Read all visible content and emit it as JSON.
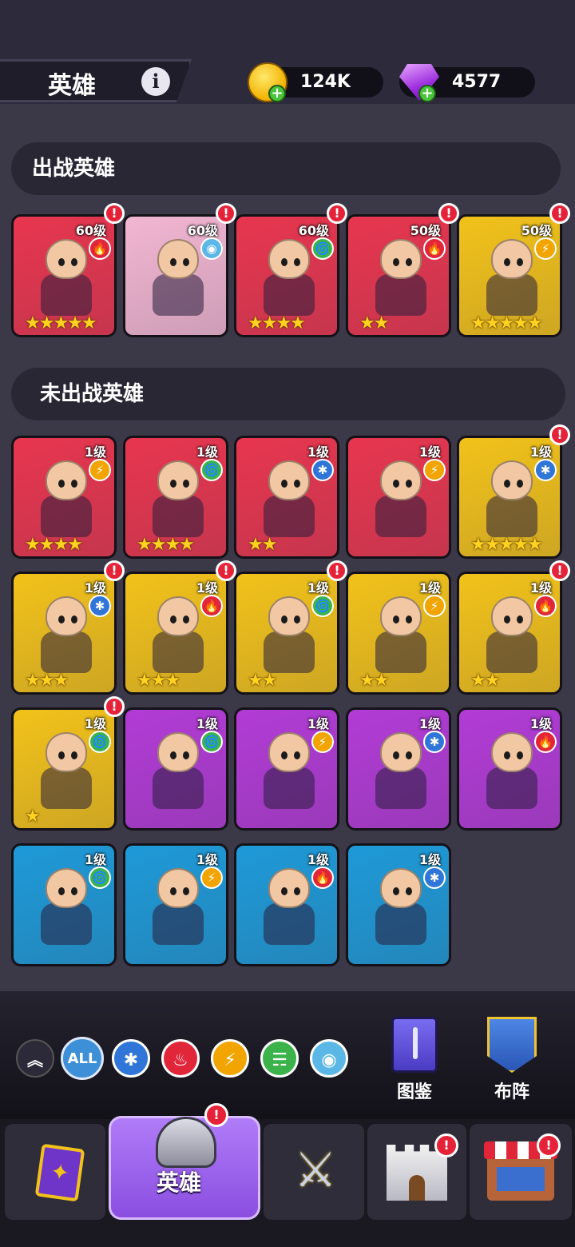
{
  "header": {
    "title": "英雄",
    "coins": "124K",
    "gems": "4577"
  },
  "sections": {
    "deployed_title": "出战英雄",
    "undeployed_title": "未出战英雄"
  },
  "deployed_heroes": [
    {
      "level": "60级",
      "element": "fire",
      "stars": "★★★★★",
      "bg": "#e8364f",
      "alert": true
    },
    {
      "level": "60级",
      "element": "eye",
      "stars": "",
      "bg": "#f2b6d2",
      "alert": true
    },
    {
      "level": "60级",
      "element": "wind",
      "stars": "★★★★",
      "bg": "#e8364f",
      "alert": true
    },
    {
      "level": "50级",
      "element": "fire",
      "stars": "★★",
      "bg": "#e8364f",
      "alert": true
    },
    {
      "level": "50级",
      "element": "lightning",
      "stars": "★★★★★",
      "bg": "#f2c21a",
      "alert": true
    }
  ],
  "undeployed_heroes": [
    {
      "level": "1级",
      "element": "lightning",
      "stars": "★★★★",
      "bg": "#e8364f",
      "alert": false
    },
    {
      "level": "1级",
      "element": "wind",
      "stars": "★★★★",
      "bg": "#e8364f",
      "alert": false
    },
    {
      "level": "1级",
      "element": "ice",
      "stars": "★★",
      "bg": "#e8364f",
      "alert": false
    },
    {
      "level": "1级",
      "element": "lightning",
      "stars": "",
      "bg": "#e8364f",
      "alert": false
    },
    {
      "level": "1级",
      "element": "ice",
      "stars": "★★★★★",
      "bg": "#f2c21a",
      "alert": true
    },
    {
      "level": "1级",
      "element": "ice",
      "stars": "★★★",
      "bg": "#f2c21a",
      "alert": true
    },
    {
      "level": "1级",
      "element": "fire",
      "stars": "★★★",
      "bg": "#f2c21a",
      "alert": true
    },
    {
      "level": "1级",
      "element": "wind",
      "stars": "★★",
      "bg": "#f2c21a",
      "alert": true
    },
    {
      "level": "1级",
      "element": "lightning",
      "stars": "★★",
      "bg": "#f2c21a",
      "alert": false
    },
    {
      "level": "1级",
      "element": "fire",
      "stars": "★★",
      "bg": "#f2c21a",
      "alert": true
    },
    {
      "level": "1级",
      "element": "wind",
      "stars": "★",
      "bg": "#f2c21a",
      "alert": true
    },
    {
      "level": "1级",
      "element": "wind",
      "stars": "",
      "bg": "#b23bd6",
      "alert": false
    },
    {
      "level": "1级",
      "element": "lightning",
      "stars": "",
      "bg": "#b23bd6",
      "alert": false
    },
    {
      "level": "1级",
      "element": "ice",
      "stars": "",
      "bg": "#b23bd6",
      "alert": false
    },
    {
      "level": "1级",
      "element": "fire",
      "stars": "",
      "bg": "#b23bd6",
      "alert": false
    },
    {
      "level": "1级",
      "element": "wind",
      "stars": "",
      "bg": "#1e9ad8",
      "alert": false
    },
    {
      "level": "1级",
      "element": "lightning",
      "stars": "",
      "bg": "#1e9ad8",
      "alert": false
    },
    {
      "level": "1级",
      "element": "fire",
      "stars": "",
      "bg": "#1e9ad8",
      "alert": false
    },
    {
      "level": "1级",
      "element": "ice",
      "stars": "",
      "bg": "#1e9ad8",
      "alert": false
    }
  ],
  "filters": {
    "all_label": "ALL"
  },
  "side_buttons": {
    "codex_label": "图鉴",
    "formation_label": "布阵"
  },
  "nav": {
    "active_label": "英雄"
  },
  "alert_glyph": "!",
  "element_glyphs": {
    "fire": "🔥",
    "ice": "✱",
    "lightning": "⚡",
    "wind": "🌀",
    "eye": "◉"
  },
  "element_colors": {
    "fire": "#e2263a",
    "ice": "#2f76d8",
    "lightning": "#f2a400",
    "wind": "#3cb34a",
    "eye": "#5bb8e6"
  }
}
